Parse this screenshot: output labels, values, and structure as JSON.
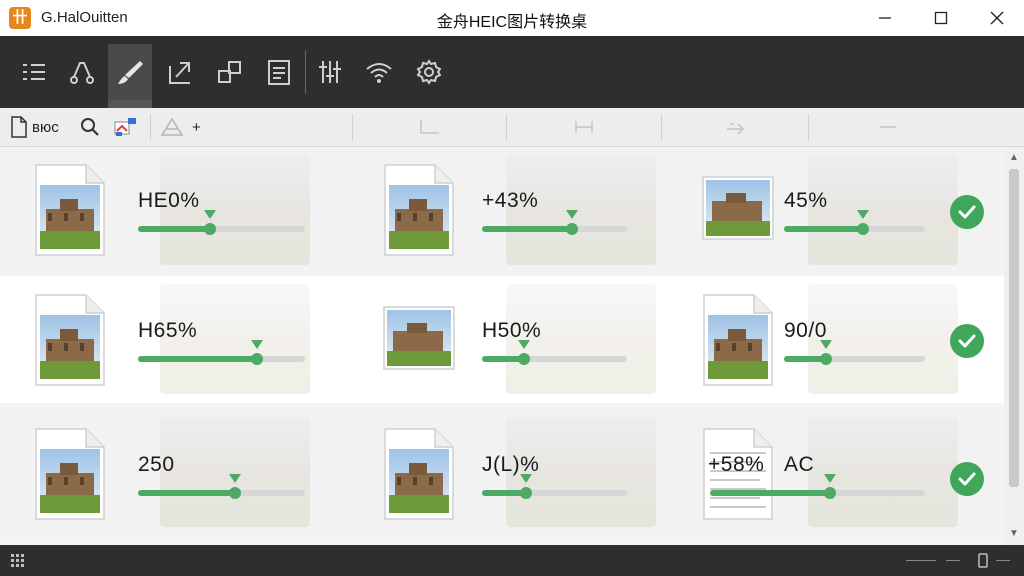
{
  "app": {
    "name": "G.HalOuitten",
    "window_title": "金舟HEIC图片转换桌",
    "icon_glyph": "卄"
  },
  "window_controls": {
    "minimize": "—",
    "maximize": "☐",
    "close": "✕"
  },
  "toolbar": {
    "icons": [
      "list-icon",
      "route-icon",
      "brush-icon",
      "export-icon",
      "resize-icon",
      "document-icon",
      "sliders-icon",
      "wifi-icon",
      "gear-icon"
    ],
    "active": "brush-icon"
  },
  "subbar": {
    "file_label": "вюс",
    "add_symbol": "+"
  },
  "files": [
    {
      "row": 1,
      "col": 1,
      "label": "HE0%",
      "progress": 0.43
    },
    {
      "row": 1,
      "col": 2,
      "label": "+43%",
      "progress": 0.62
    },
    {
      "row": 1,
      "col": 3,
      "label": "45%",
      "progress": 0.56
    },
    {
      "row": 2,
      "col": 1,
      "label": "H65%",
      "progress": 0.71
    },
    {
      "row": 2,
      "col": 2,
      "label": "H50%",
      "progress": 0.29
    },
    {
      "row": 2,
      "col": 3,
      "label": "90/0",
      "progress": 0.3
    },
    {
      "row": 3,
      "col": 1,
      "label": "250",
      "progress": 0.58
    },
    {
      "row": 3,
      "col": 2,
      "label": "J(L)%",
      "progress": 0.3
    },
    {
      "row": 3,
      "col": 3,
      "label": "+58%",
      "label2": "AC",
      "progress": 0.56
    }
  ],
  "colors": {
    "accent": "#4caa64",
    "check": "#3fa65a",
    "toolbar": "#2e2e2e",
    "app_icon": "#e8871e"
  }
}
